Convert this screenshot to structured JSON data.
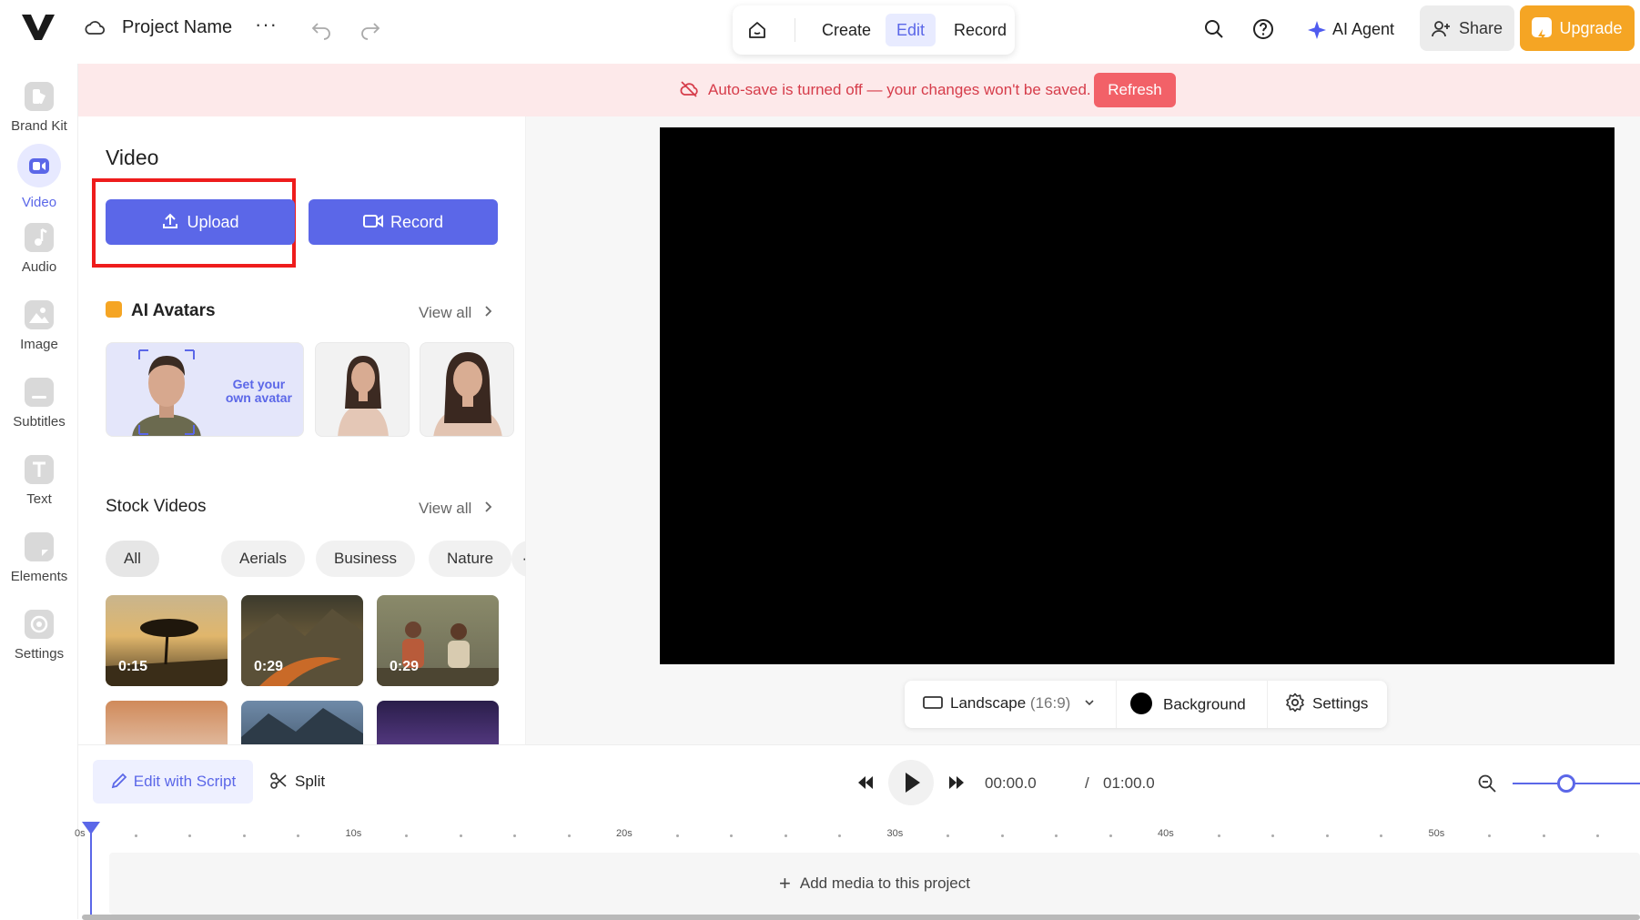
{
  "header": {
    "project_name": "Project Name",
    "more_label": "···",
    "modes": {
      "create": "Create",
      "edit": "Edit",
      "record": "Record"
    },
    "ai_agent_label": "AI Agent",
    "share_label": "Share",
    "upgrade_label": "Upgrade"
  },
  "sidebar": {
    "items": [
      {
        "label": "Brand Kit",
        "icon": "brand-kit-icon"
      },
      {
        "label": "Video",
        "icon": "video-icon",
        "active": true
      },
      {
        "label": "Audio",
        "icon": "music-note-icon"
      },
      {
        "label": "Image",
        "icon": "image-icon"
      },
      {
        "label": "Subtitles",
        "icon": "subtitles-icon"
      },
      {
        "label": "Text",
        "icon": "text-icon"
      },
      {
        "label": "Elements",
        "icon": "elements-icon"
      },
      {
        "label": "Settings",
        "icon": "settings-icon"
      }
    ]
  },
  "banner": {
    "message": "Auto-save is turned off — your changes won't be saved.",
    "refresh_label": "Refresh"
  },
  "panel": {
    "title": "Video",
    "upload_label": "Upload",
    "record_label": "Record",
    "ai_avatars": {
      "heading": "AI Avatars",
      "view_all": "View all",
      "own_avatar_line1": "Get your",
      "own_avatar_line2": "own avatar"
    },
    "stock": {
      "heading": "Stock Videos",
      "view_all": "View all",
      "chips": [
        "All",
        "Aerials",
        "Business",
        "Nature"
      ],
      "more_chip": "···",
      "videos": [
        {
          "duration": "0:15"
        },
        {
          "duration": "0:29"
        },
        {
          "duration": "0:29"
        },
        {
          "duration": ""
        },
        {
          "duration": ""
        },
        {
          "duration": ""
        }
      ]
    }
  },
  "canvas_toolbar": {
    "orientation": "Landscape",
    "ratio": "(16:9)",
    "background_label": "Background",
    "settings_label": "Settings"
  },
  "timeline": {
    "edit_script_label": "Edit with Script",
    "split_label": "Split",
    "current_time": "00:00.0",
    "separator": "/",
    "total_time": "01:00.0",
    "ruler_labels": [
      "0s",
      "10s",
      "20s",
      "30s",
      "40s",
      "50s"
    ],
    "add_media_label": "Add media to this project",
    "zoom_level": 0.42
  },
  "colors": {
    "accent": "#5b67e8",
    "upgrade": "#f5a524",
    "banner_bg": "#fde9ea",
    "banner_text": "#d63c4a",
    "refresh": "#f26168",
    "highlight": "#ee1c1c"
  }
}
